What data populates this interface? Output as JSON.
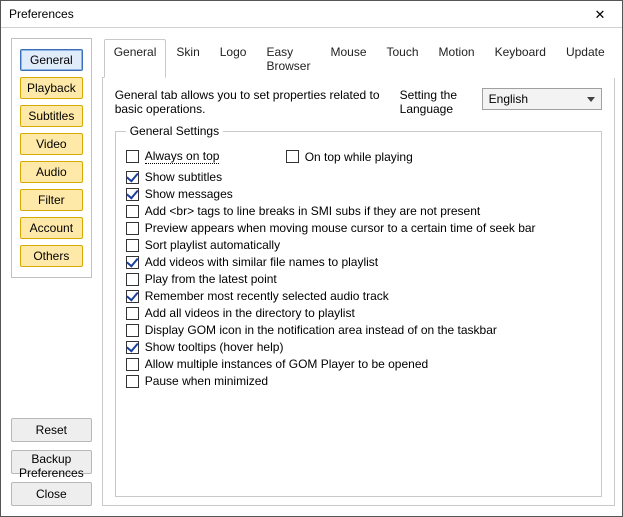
{
  "window": {
    "title": "Preferences"
  },
  "sidebar": {
    "items": [
      "General",
      "Playback",
      "Subtitles",
      "Video",
      "Audio",
      "Filter",
      "Account",
      "Others"
    ],
    "active": 0,
    "reset": "Reset",
    "backup": "Backup Preferences",
    "close": "Close"
  },
  "tabs": {
    "items": [
      "General",
      "Skin",
      "Logo",
      "Easy Browser",
      "Mouse",
      "Touch",
      "Motion",
      "Keyboard",
      "Update"
    ],
    "active": 0
  },
  "panel": {
    "desc": "General tab allows you to set properties related to basic operations.",
    "lang_label": "Setting the Language",
    "lang_value": "English",
    "group_title": "General Settings",
    "row0": {
      "always_on_top": {
        "label": "Always on top",
        "checked": false
      },
      "on_top_playing": {
        "label": "On top while playing",
        "checked": false
      }
    },
    "opts": [
      {
        "label": "Show subtitles",
        "checked": true
      },
      {
        "label": "Show messages",
        "checked": true
      },
      {
        "label": "Add <br> tags to line breaks in SMI subs if they are not present",
        "checked": false
      },
      {
        "label": "Preview appears when moving mouse cursor to a certain time of seek bar",
        "checked": false
      },
      {
        "label": "Sort playlist automatically",
        "checked": false
      },
      {
        "label": "Add videos with similar file names to playlist",
        "checked": true
      },
      {
        "label": "Play from the latest point",
        "checked": false
      },
      {
        "label": "Remember most recently selected audio track",
        "checked": true
      },
      {
        "label": "Add all videos in the directory to playlist",
        "checked": false
      },
      {
        "label": "Display GOM icon in the notification area instead of on the taskbar",
        "checked": false
      },
      {
        "label": "Show tooltips (hover help)",
        "checked": true
      },
      {
        "label": "Allow multiple instances of GOM Player to be opened",
        "checked": false
      },
      {
        "label": "Pause when minimized",
        "checked": false
      }
    ]
  }
}
